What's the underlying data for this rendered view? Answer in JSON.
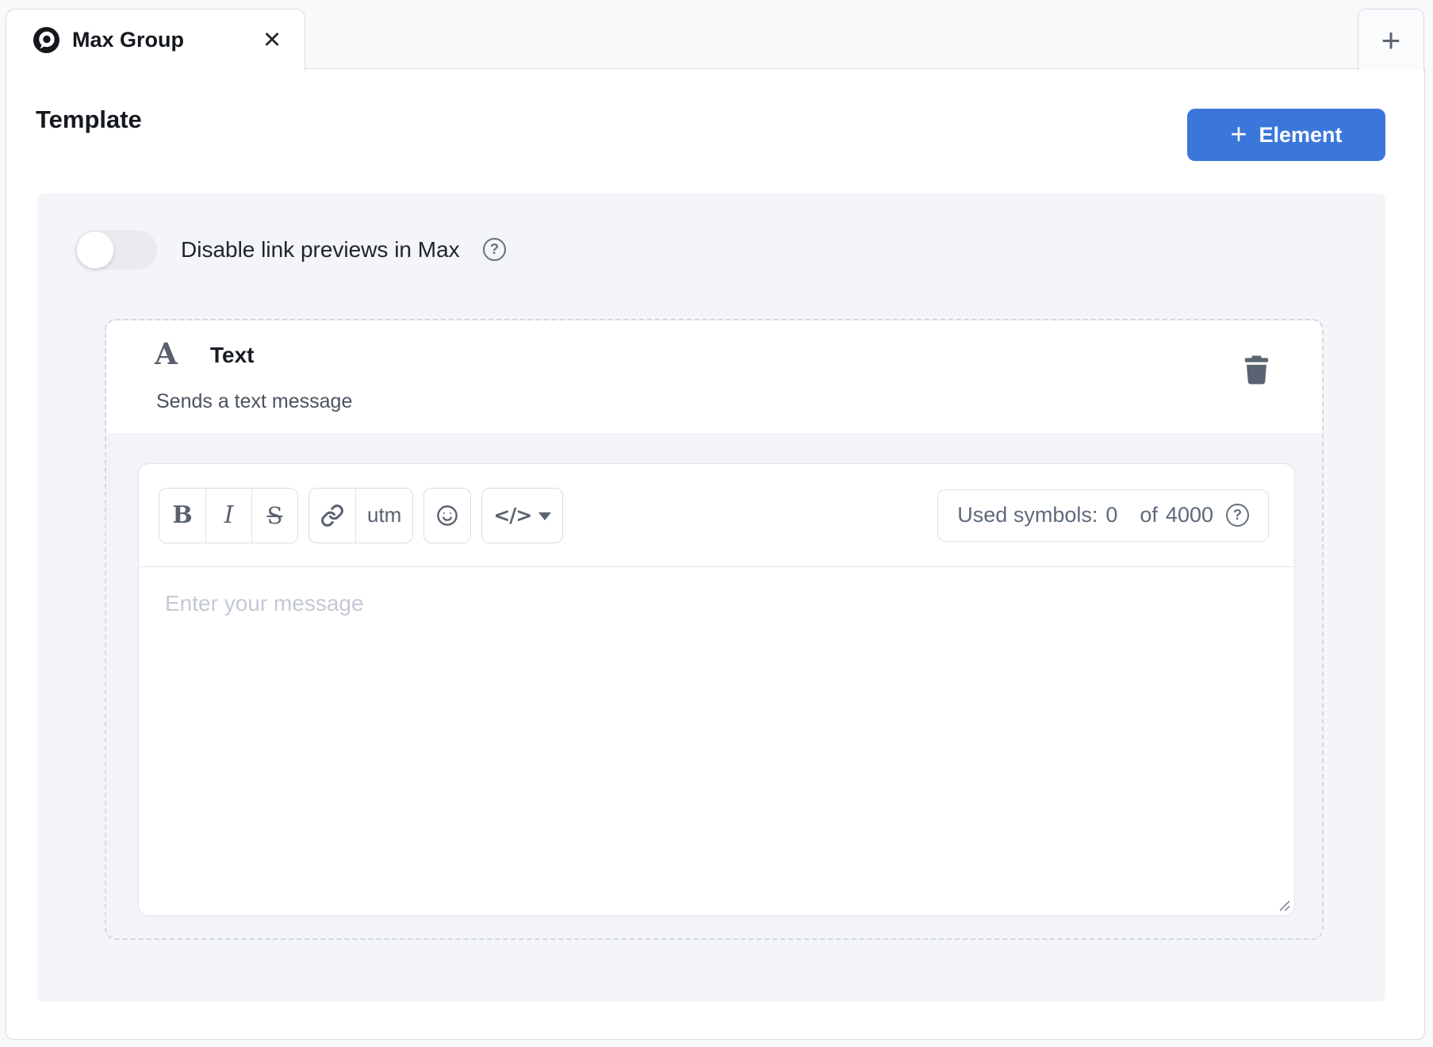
{
  "tabs": {
    "active": {
      "title": "Max Group"
    },
    "close_icon": "✕",
    "new_tab_icon": "+"
  },
  "header": {
    "title": "Template",
    "add_element": {
      "plus_icon": "+",
      "label": "Element"
    }
  },
  "settings": {
    "toggle_label": "Disable link previews in Max",
    "toggle_state": "off",
    "help_icon": "?"
  },
  "element": {
    "type_icon": "A",
    "title": "Text",
    "subtitle": "Sends a text message",
    "delete_icon": "trash"
  },
  "toolbar": {
    "bold": "B",
    "italic": "I",
    "strikethrough": "S",
    "link_icon": "chain-link",
    "utm_label": "utm",
    "emoji_icon": "smiley-face",
    "code_label": "</>",
    "caret_icon": "chevron-down"
  },
  "counter": {
    "label": "Used symbols:",
    "used": "0",
    "of": "of",
    "limit": "4000",
    "help_icon": "?"
  },
  "message": {
    "placeholder": "Enter your message",
    "value": ""
  },
  "colors": {
    "accent_blue": "#3b77db",
    "icon_gray": "#5a6372",
    "panel_bg": "#f4f5f8",
    "card_body_bg": "#f2f4f9",
    "dashed_border": "#d3d7df"
  }
}
